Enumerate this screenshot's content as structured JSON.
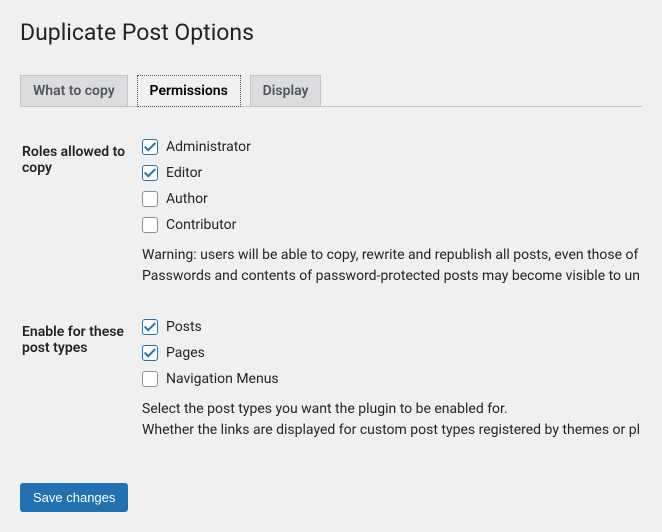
{
  "page": {
    "title": "Duplicate Post Options"
  },
  "tabs": [
    {
      "label": "What to copy",
      "active": false
    },
    {
      "label": "Permissions",
      "active": true
    },
    {
      "label": "Display",
      "active": false
    }
  ],
  "sections": {
    "roles": {
      "heading": "Roles allowed to copy",
      "options": [
        {
          "label": "Administrator",
          "checked": true
        },
        {
          "label": "Editor",
          "checked": true
        },
        {
          "label": "Author",
          "checked": false
        },
        {
          "label": "Contributor",
          "checked": false
        }
      ],
      "description_line1": "Warning: users will be able to copy, rewrite and republish all posts, even those of",
      "description_line2": "Passwords and contents of password-protected posts may become visible to un"
    },
    "post_types": {
      "heading": "Enable for these post types",
      "options": [
        {
          "label": "Posts",
          "checked": true
        },
        {
          "label": "Pages",
          "checked": true
        },
        {
          "label": "Navigation Menus",
          "checked": false
        }
      ],
      "description_line1": "Select the post types you want the plugin to be enabled for.",
      "description_line2": "Whether the links are displayed for custom post types registered by themes or pl"
    }
  },
  "buttons": {
    "save": "Save changes"
  }
}
